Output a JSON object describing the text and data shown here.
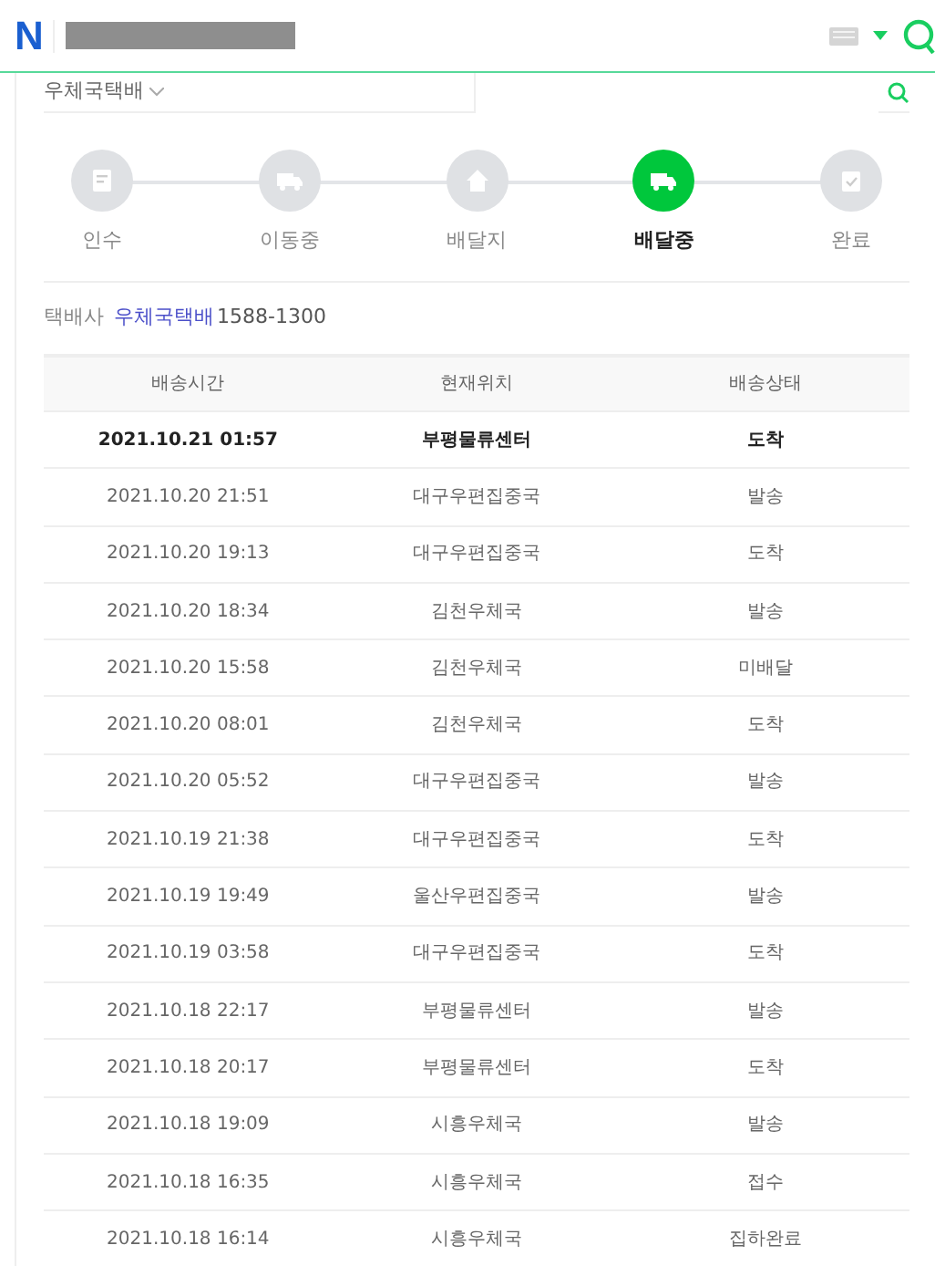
{
  "header": {
    "logo": "N"
  },
  "search": {
    "carrier": "우체국택배"
  },
  "steps": [
    {
      "label": "인수",
      "kind": "note",
      "selected": false
    },
    {
      "label": "이동중",
      "kind": "truck",
      "selected": false
    },
    {
      "label": "배달지",
      "kind": "house",
      "selected": false
    },
    {
      "label": "배달중",
      "kind": "truck",
      "selected": true
    },
    {
      "label": "완료",
      "kind": "check",
      "selected": false
    }
  ],
  "carrier_info": {
    "label": "택배사",
    "name": "우체국택배",
    "phone": "1588-1300"
  },
  "table": {
    "columns": [
      "배송시간",
      "현재위치",
      "배송상태"
    ],
    "rows": [
      {
        "cells": [
          "2021.10.21 01:57",
          "부평물류센터",
          "도착"
        ],
        "current": true
      },
      {
        "cells": [
          "2021.10.20 21:51",
          "대구우편집중국",
          "발송"
        ],
        "current": false
      },
      {
        "cells": [
          "2021.10.20 19:13",
          "대구우편집중국",
          "도착"
        ],
        "current": false
      },
      {
        "cells": [
          "2021.10.20 18:34",
          "김천우체국",
          "발송"
        ],
        "current": false
      },
      {
        "cells": [
          "2021.10.20 15:58",
          "김천우체국",
          "미배달"
        ],
        "current": false
      },
      {
        "cells": [
          "2021.10.20 08:01",
          "김천우체국",
          "도착"
        ],
        "current": false
      },
      {
        "cells": [
          "2021.10.20 05:52",
          "대구우편집중국",
          "발송"
        ],
        "current": false
      },
      {
        "cells": [
          "2021.10.19 21:38",
          "대구우편집중국",
          "도착"
        ],
        "current": false
      },
      {
        "cells": [
          "2021.10.19 19:49",
          "울산우편집중국",
          "발송"
        ],
        "current": false
      },
      {
        "cells": [
          "2021.10.19 03:58",
          "대구우편집중국",
          "도착"
        ],
        "current": false
      },
      {
        "cells": [
          "2021.10.18 22:17",
          "부평물류센터",
          "발송"
        ],
        "current": false
      },
      {
        "cells": [
          "2021.10.18 20:17",
          "부평물류센터",
          "도착"
        ],
        "current": false
      },
      {
        "cells": [
          "2021.10.18 19:09",
          "시흥우체국",
          "발송"
        ],
        "current": false
      },
      {
        "cells": [
          "2021.10.18 16:35",
          "시흥우체국",
          "접수"
        ],
        "current": false
      },
      {
        "cells": [
          "2021.10.18 16:14",
          "시흥우체국",
          "집하완료"
        ],
        "current": false
      }
    ]
  }
}
